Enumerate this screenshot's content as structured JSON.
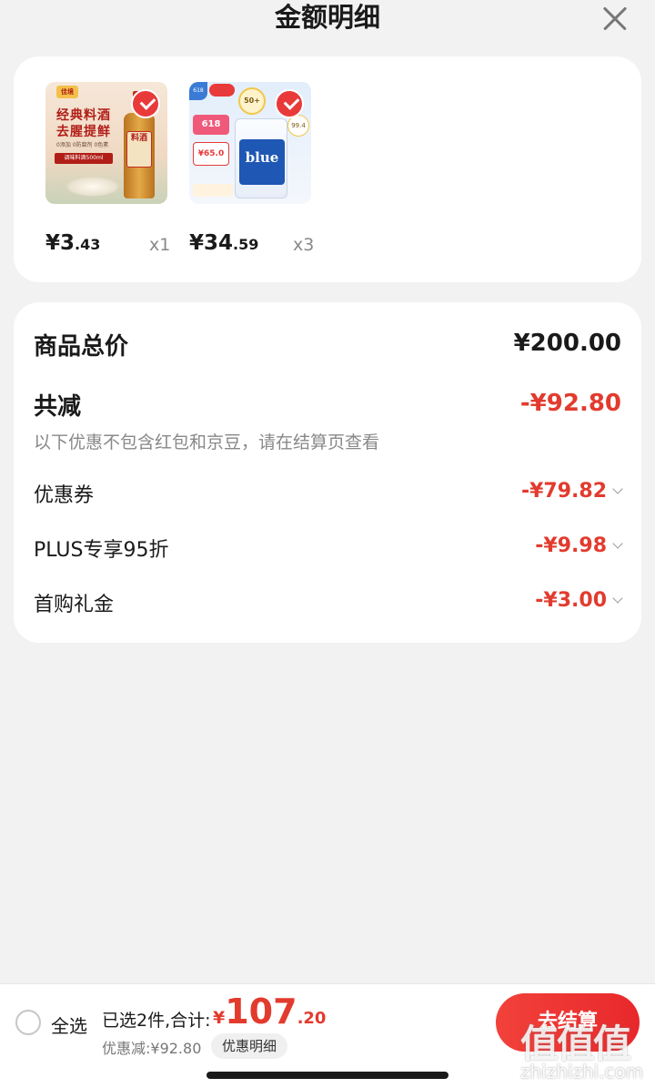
{
  "header": {
    "title": "金额明细",
    "close_icon": "close-icon"
  },
  "products": [
    {
      "image_texts": {
        "logo": "佳境",
        "slogan_line1": "经典料酒",
        "slogan_line2": "去腥提鲜",
        "tags": "0添加 0防腐剂 0色素",
        "label": "调味料酒500ml",
        "bottle_label": "料酒"
      },
      "price_int": "¥3",
      "price_dec": ".43",
      "qty": "x1",
      "selected": true
    },
    {
      "image_texts": {
        "corner": "618",
        "badge": "50+",
        "promo": "618",
        "price_box": "¥65.0",
        "bag_brand": "blue",
        "ratio": "99.4"
      },
      "price_int": "¥34",
      "price_dec": ".59",
      "qty": "x3",
      "selected": true
    }
  ],
  "summary": {
    "total_label": "商品总价",
    "total_value": "¥200.00",
    "reduce_label": "共减",
    "reduce_value": "-¥92.80",
    "note": "以下优惠不包含红包和京豆，请在结算页查看",
    "items": [
      {
        "label": "优惠券",
        "value": "-¥79.82"
      },
      {
        "label": "PLUS专享95折",
        "value": "-¥9.98"
      },
      {
        "label": "首购礼金",
        "value": "-¥3.00"
      }
    ]
  },
  "bottom_bar": {
    "select_all": "全选",
    "selected_text": "已选2件,合计:",
    "total_symbol": "¥",
    "total_int": "107",
    "total_dec": ".20",
    "discount_text": "优惠减:¥92.80",
    "detail_button": "优惠明细",
    "checkout_button": "去结算",
    "watermark": "值值值",
    "watermark_url": "zhizhizhi.com"
  },
  "colors": {
    "accent_red": "#e23b2e",
    "background": "#f2f2f2",
    "card": "#ffffff"
  }
}
